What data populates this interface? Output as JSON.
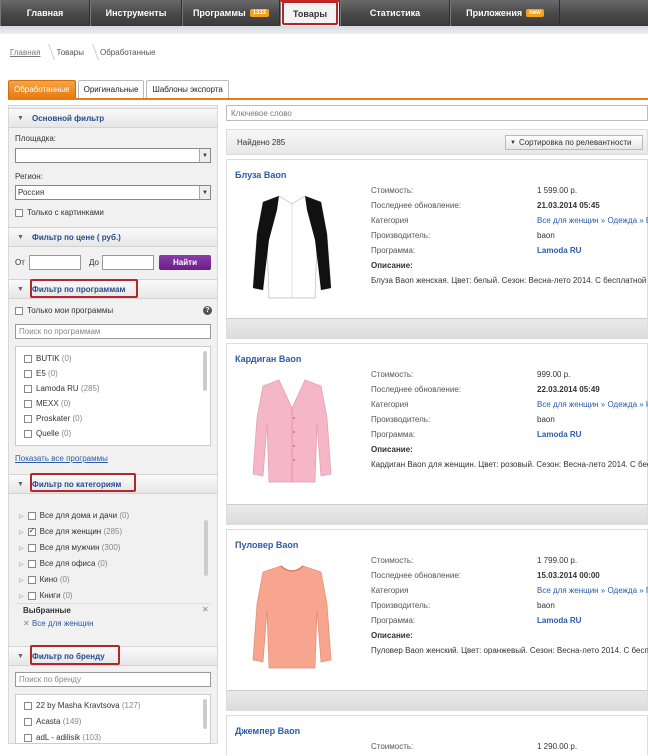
{
  "nav": {
    "items": [
      {
        "label": "Главная",
        "badge": ""
      },
      {
        "label": "Инструменты",
        "badge": ""
      },
      {
        "label": "Программы",
        "badge": "1333"
      },
      {
        "label": "Товары",
        "badge": ""
      },
      {
        "label": "Статистика",
        "badge": ""
      },
      {
        "label": "Приложения",
        "badge": "new"
      }
    ]
  },
  "breadcrumb": [
    "Главная",
    "Товары",
    "Обработанные"
  ],
  "tabs": [
    "Обработанные",
    "Оригинальные",
    "Шаблоны экспорта"
  ],
  "filters": {
    "main": {
      "title": "Основной фильтр",
      "platform_label": "Площадка:",
      "platform_value": "",
      "region_label": "Регион:",
      "region_value": "Россия",
      "pictures_only": "Только с картинками"
    },
    "price": {
      "title": "Фильтр по цене ( руб.)",
      "from": "От",
      "to": "До",
      "button": "Найти"
    },
    "programs": {
      "title": "Фильтр по программам",
      "only_mine": "Только мои программы",
      "search_placeholder": "Поиск по программам",
      "items": [
        {
          "name": "BUTIK",
          "count": "(0)"
        },
        {
          "name": "E5",
          "count": "(0)"
        },
        {
          "name": "Lamoda RU",
          "count": "(285)"
        },
        {
          "name": "MEXX",
          "count": "(0)"
        },
        {
          "name": "Proskater",
          "count": "(0)"
        },
        {
          "name": "Quelle",
          "count": "(0)"
        }
      ],
      "show_all": "Показать все программы"
    },
    "categories": {
      "title": "Фильтр по категориям",
      "items": [
        {
          "name": "Все для дома и дачи",
          "count": "(0)"
        },
        {
          "name": "Все для женщин",
          "count": "(285)"
        },
        {
          "name": "Все для мужчин",
          "count": "(300)"
        },
        {
          "name": "Все для офиса",
          "count": "(0)"
        },
        {
          "name": "Кино",
          "count": "(0)"
        },
        {
          "name": "Книги",
          "count": "(0)"
        }
      ],
      "selected_title": "Выбранные",
      "selected_item": "Все для женщин"
    },
    "brand": {
      "title": "Фильтр по бренду",
      "search_placeholder": "Поиск по бренду",
      "items": [
        {
          "name": "22 by Masha Kravtsova",
          "count": "(127)"
        },
        {
          "name": "Acasta",
          "count": "(149)"
        },
        {
          "name": "adL - adilisik",
          "count": "(103)"
        }
      ]
    }
  },
  "results": {
    "search_placeholder": "Ключевое слово",
    "found": "Найдено 285",
    "sort": "Сортировка по релевантности",
    "labels": {
      "cost": "Стоимость:",
      "updated": "Последнее обновление:",
      "category": "Категория",
      "maker": "Производитель:",
      "program": "Программа:",
      "desc": "Описание:"
    },
    "products": [
      {
        "title": "Блуза Baon",
        "cost": "1 599.00 р.",
        "updated": "21.03.2014 05:45",
        "category": "Все для женщин » Одежда » Б",
        "maker": "baon",
        "program": "Lamoda RU",
        "desc": "Блуза Baon женская. Цвет: белый. Сезон: Весна-лето 2014. С бесплатной до"
      },
      {
        "title": "Кардиган Baon",
        "cost": "999.00 р.",
        "updated": "22.03.2014 05:49",
        "category": "Все для женщин » Одежда » К",
        "maker": "baon",
        "program": "Lamoda RU",
        "desc": "Кардиган Baon для женщин. Цвет: розовый. Сезон: Весна-лето 2014. С беспл"
      },
      {
        "title": "Пуловер Baon",
        "cost": "1 799.00 р.",
        "updated": "15.03.2014 00:00",
        "category": "Все для женщин » Одежда » П",
        "maker": "baon",
        "program": "Lamoda RU",
        "desc": "Пуловер Baon женский. Цвет: оранжевый. Сезон: Весна-лето 2014. С беспла"
      },
      {
        "title": "Джемпер Baon",
        "cost": "1 290.00 р.",
        "updated": "",
        "category": "",
        "maker": "",
        "program": "",
        "desc": ""
      }
    ]
  },
  "colors": {
    "accent_orange": "#e77c0f",
    "link_blue": "#2c5ba8",
    "highlight_red": "#b3262c",
    "button_purple": "#7a2a98"
  }
}
